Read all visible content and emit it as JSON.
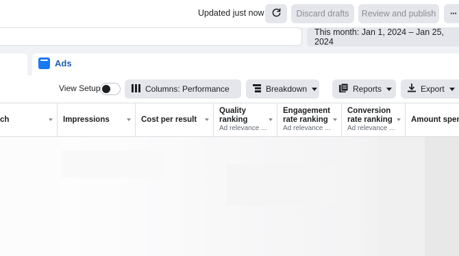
{
  "topbar": {
    "status": "Updated just now",
    "discard_label": "Discard drafts",
    "review_label": "Review and publish",
    "more_label": "···"
  },
  "date_range": {
    "label": "This month: Jan 1, 2024 – Jan 25, 2024"
  },
  "tabs": {
    "ads_label": "Ads"
  },
  "toolbar": {
    "view_setup_label": "View Setup",
    "columns_label": "Columns: Performance",
    "breakdown_label": "Breakdown",
    "reports_label": "Reports",
    "export_label": "Export"
  },
  "table": {
    "columns": [
      {
        "title": "ch",
        "sub": ""
      },
      {
        "title": "Impressions",
        "sub": ""
      },
      {
        "title": "Cost per result",
        "sub": ""
      },
      {
        "title": "Quality ranking",
        "title_line2": "ranking",
        "title_line1": "Quality",
        "sub": "Ad relevance ..."
      },
      {
        "title_line1": "Engagement",
        "title_line2": "rate ranking",
        "sub": "Ad relevance ..."
      },
      {
        "title_line1": "Conversion",
        "title_line2": "rate ranking",
        "sub": "Ad relevance ..."
      },
      {
        "title": "Amount spent",
        "sub": ""
      }
    ]
  },
  "colors": {
    "accent": "#1877f2",
    "tab_text": "#1c5cab",
    "click_marker": "#4285f4"
  },
  "icons": [
    "refresh-icon",
    "more-icon",
    "ads-icon",
    "columns-icon",
    "breakdown-icon",
    "reports-icon",
    "export-icon",
    "caret-down-icon"
  ]
}
